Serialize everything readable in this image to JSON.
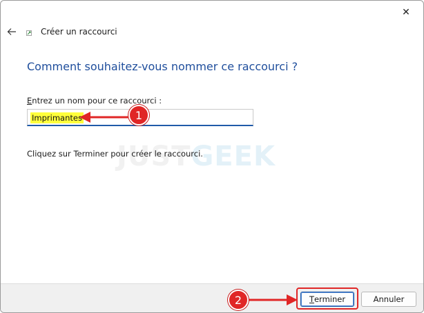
{
  "window": {
    "title": "Créer un raccourci",
    "close_glyph": "✕"
  },
  "main": {
    "heading": "Comment souhaitez-vous nommer ce raccourci ?",
    "field_label_first": "E",
    "field_label_rest": "ntrez un nom pour ce raccourci :",
    "name_value": "Imprimantes",
    "info_text": "Cliquez sur Terminer pour créer le raccourci."
  },
  "watermark": {
    "part1": "JUST",
    "part2": "GEEK"
  },
  "footer": {
    "terminer_first": "T",
    "terminer_rest": "erminer",
    "annuler_label": "Annuler"
  },
  "annotations": {
    "badge1": "1",
    "badge2": "2",
    "color": "#e02626"
  },
  "colors": {
    "heading": "#1f4e9c",
    "input_focus": "#1f5aa8",
    "highlight": "#ffff3c"
  }
}
